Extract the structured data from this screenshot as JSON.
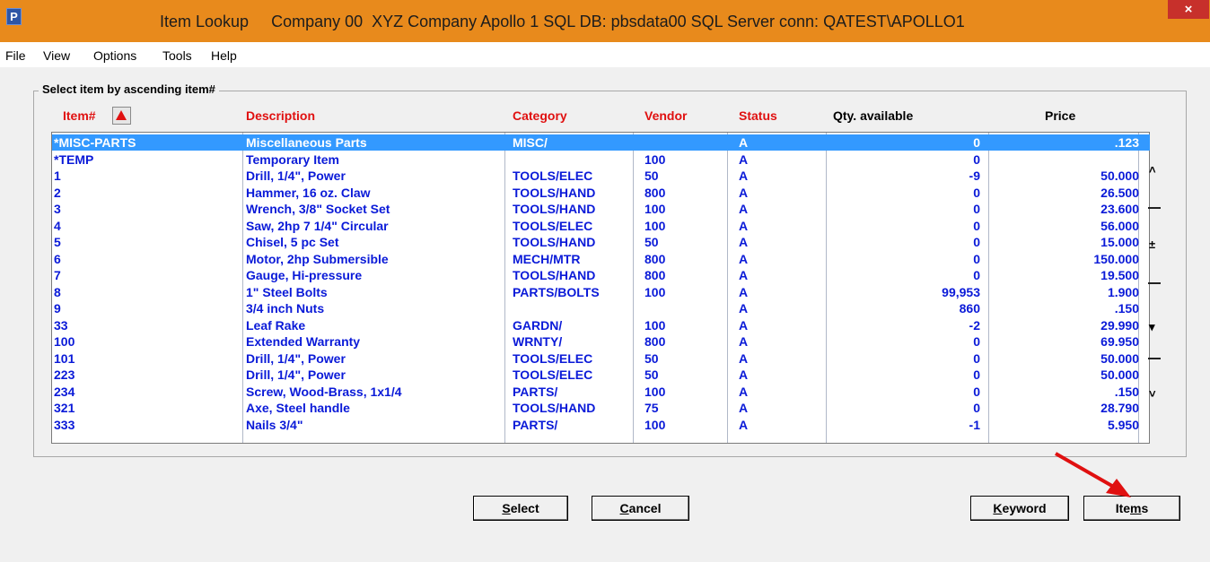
{
  "window": {
    "app_icon": "P",
    "title": "Item Lookup     Company 00  XYZ Company Apollo 1 SQL DB: pbsdata00 SQL Server conn: QATEST\\APOLLO1",
    "close_icon": "×"
  },
  "menu": [
    "File",
    "View",
    "Options",
    "Tools",
    "Help"
  ],
  "group_title": "Select item by ascending item#",
  "columns": {
    "item": "Item#",
    "description": "Description",
    "category": "Category",
    "vendor": "Vendor",
    "status": "Status",
    "qty": "Qty. available",
    "price": "Price"
  },
  "rows": [
    {
      "item": "*MISC-PARTS",
      "desc": "Miscellaneous Parts",
      "cat": "MISC/",
      "vendor": "",
      "status": "A",
      "qty": "0",
      "price": ".123"
    },
    {
      "item": "*TEMP",
      "desc": "Temporary Item",
      "cat": "",
      "vendor": "100",
      "status": "A",
      "qty": "0",
      "price": ""
    },
    {
      "item": "1",
      "desc": "Drill, 1/4\", Power",
      "cat": "TOOLS/ELEC",
      "vendor": "50",
      "status": "A",
      "qty": "-9",
      "price": "50.000"
    },
    {
      "item": "2",
      "desc": "Hammer, 16 oz. Claw",
      "cat": "TOOLS/HAND",
      "vendor": "800",
      "status": "A",
      "qty": "0",
      "price": "26.500"
    },
    {
      "item": "3",
      "desc": "Wrench, 3/8\" Socket Set",
      "cat": "TOOLS/HAND",
      "vendor": "100",
      "status": "A",
      "qty": "0",
      "price": "23.600"
    },
    {
      "item": "4",
      "desc": "Saw, 2hp 7 1/4\" Circular",
      "cat": "TOOLS/ELEC",
      "vendor": "100",
      "status": "A",
      "qty": "0",
      "price": "56.000"
    },
    {
      "item": "5",
      "desc": "Chisel, 5 pc Set",
      "cat": "TOOLS/HAND",
      "vendor": "50",
      "status": "A",
      "qty": "0",
      "price": "15.000"
    },
    {
      "item": "6",
      "desc": "Motor, 2hp Submersible",
      "cat": "MECH/MTR",
      "vendor": "800",
      "status": "A",
      "qty": "0",
      "price": "150.000"
    },
    {
      "item": "7",
      "desc": "Gauge, Hi-pressure",
      "cat": "TOOLS/HAND",
      "vendor": "800",
      "status": "A",
      "qty": "0",
      "price": "19.500"
    },
    {
      "item": "8",
      "desc": "1\" Steel Bolts",
      "cat": "PARTS/BOLTS",
      "vendor": "100",
      "status": "A",
      "qty": "99,953",
      "price": "1.900"
    },
    {
      "item": "9",
      "desc": "3/4 inch Nuts",
      "cat": "",
      "vendor": "",
      "status": "A",
      "qty": "860",
      "price": ".150"
    },
    {
      "item": "33",
      "desc": "Leaf Rake",
      "cat": "GARDN/",
      "vendor": "100",
      "status": "A",
      "qty": "-2",
      "price": "29.990"
    },
    {
      "item": "100",
      "desc": "Extended Warranty",
      "cat": "WRNTY/",
      "vendor": "800",
      "status": "A",
      "qty": "0",
      "price": "69.950"
    },
    {
      "item": "101",
      "desc": "Drill, 1/4\", Power",
      "cat": "TOOLS/ELEC",
      "vendor": "50",
      "status": "A",
      "qty": "0",
      "price": "50.000"
    },
    {
      "item": "223",
      "desc": "Drill, 1/4\", Power",
      "cat": "TOOLS/ELEC",
      "vendor": "50",
      "status": "A",
      "qty": "0",
      "price": "50.000"
    },
    {
      "item": "234",
      "desc": "Screw, Wood-Brass, 1x1/4",
      "cat": "PARTS/",
      "vendor": "100",
      "status": "A",
      "qty": "0",
      "price": ".150"
    },
    {
      "item": "321",
      "desc": "Axe, Steel handle",
      "cat": "TOOLS/HAND",
      "vendor": "75",
      "status": "A",
      "qty": "0",
      "price": "28.790"
    },
    {
      "item": "333",
      "desc": "Nails 3/4\"",
      "cat": "PARTS/",
      "vendor": "100",
      "status": "A",
      "qty": "-1",
      "price": "5.950"
    }
  ],
  "selected_row": 0,
  "scroll_symbols": {
    "line_up": "˄",
    "page_updown": "±",
    "page_down": "▾",
    "line_down": "˅"
  },
  "buttons": {
    "select": {
      "accel": "S",
      "rest": "elect"
    },
    "cancel": {
      "accel": "C",
      "rest": "ancel"
    },
    "keyword": {
      "accel": "K",
      "rest": "eyword"
    },
    "items": {
      "pre": "Ite",
      "accel": "m",
      "post": "s"
    }
  },
  "colors": {
    "title_bar": "#e88a1c",
    "header_red": "#e01010",
    "row_text": "#0a1ad8",
    "selection": "#3399ff",
    "arrow": "#e01010"
  }
}
